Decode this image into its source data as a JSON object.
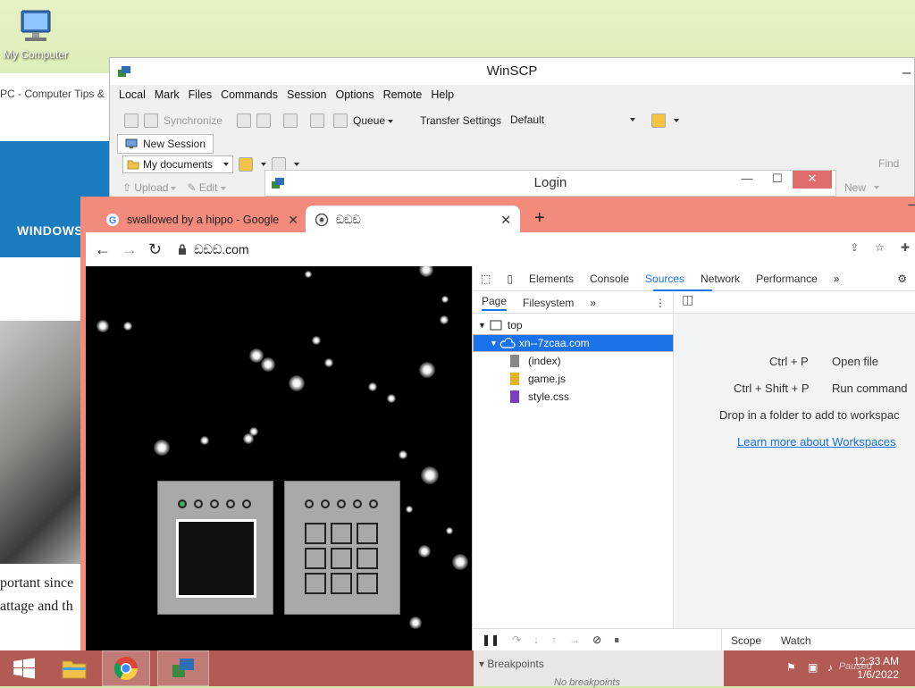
{
  "desktop": {
    "my_computer_label": "My Computer"
  },
  "bg_page": {
    "tips_text": "PC - Computer Tips &",
    "banner_text": "WINDOWS",
    "text_line1": "portant since",
    "text_line2": "attage and th"
  },
  "winscp": {
    "title": "WinSCP",
    "menu": [
      "Local",
      "Mark",
      "Files",
      "Commands",
      "Session",
      "Options",
      "Remote",
      "Help"
    ],
    "toolbar": {
      "synchronize": "Synchronize",
      "queue": "Queue",
      "transfer_settings_label": "Transfer Settings",
      "transfer_settings_value": "Default"
    },
    "new_session": "New Session",
    "local_path": "My documents",
    "upload": "Upload",
    "edit": "Edit",
    "find": "Find",
    "new": "New"
  },
  "login": {
    "title": "Login"
  },
  "chrome": {
    "tabs": [
      {
        "title": "swallowed by a hippo - Google S",
        "active": false
      },
      {
        "title": "ඞඞඞ",
        "active": true
      }
    ],
    "url": "ඞඞඞ.com",
    "devtools": {
      "tabs": [
        "Elements",
        "Console",
        "Sources",
        "Network",
        "Performance"
      ],
      "active_tab": "Sources",
      "navigator_tabs": [
        "Page",
        "Filesystem"
      ],
      "tree": {
        "top": "top",
        "domain": "xn--7zcaa.com",
        "files": [
          "(index)",
          "game.js",
          "style.css"
        ]
      },
      "shortcuts": [
        {
          "keys": "Ctrl + P",
          "label": "Open file"
        },
        {
          "keys": "Ctrl + Shift + P",
          "label": "Run command"
        }
      ],
      "drop_text": "Drop in a folder to add to workspac",
      "learn_more": "Learn more about Workspaces",
      "bottom_tabs": [
        "Scope",
        "Watch"
      ],
      "breakpoints_header": "Breakpoints",
      "no_breakpoints": "No breakpoints"
    }
  },
  "taskbar": {
    "time": "12:33 AM",
    "date": "1/6/2022",
    "paused": "Paused"
  },
  "colors": {
    "chrome_frame": "#f28b7c",
    "taskbar": "#b25a54",
    "accent": "#1a73e8"
  }
}
